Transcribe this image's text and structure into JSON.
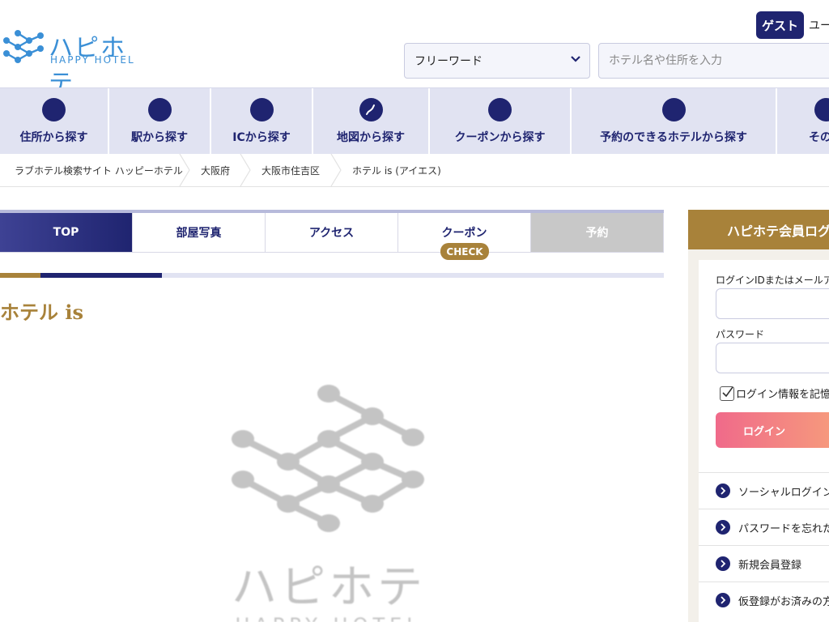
{
  "header": {
    "logo_jp": "ハピホテ",
    "logo_en": "HAPPY HOTEL",
    "guest_badge": "ゲスト",
    "user_text": "ユー",
    "search_type_selected": "フリーワード",
    "search_placeholder": "ホテル名や住所を入力"
  },
  "nav": {
    "items": [
      {
        "label": "住所から探す",
        "icon": "circle-icon"
      },
      {
        "label": "駅から探す",
        "icon": "circle-icon"
      },
      {
        "label": "ICから探す",
        "icon": "circle-icon"
      },
      {
        "label": "地図から探す",
        "icon": "japan-map-icon"
      },
      {
        "label": "クーポンから探す",
        "icon": "circle-icon"
      },
      {
        "label": "予約のできるホテルから探す",
        "icon": "circle-icon"
      },
      {
        "label": "その他",
        "icon": "circle-icon"
      }
    ]
  },
  "breadcrumb": {
    "items": [
      "ラブホテル検索サイト ハッピーホテル",
      "大阪府",
      "大阪市住吉区",
      "ホテル is (アイエス)"
    ]
  },
  "tabs": {
    "items": [
      "TOP",
      "部屋写真",
      "アクセス",
      "クーポン",
      "予約"
    ],
    "check_badge": "CHECK"
  },
  "hotel": {
    "title": "ホテル is",
    "placeholder_jp": "ハピホテ",
    "placeholder_en": "HAPPY HOTEL"
  },
  "sidebar": {
    "title": "ハピホテ会員ログイン",
    "login_id_label": "ログインIDまたはメールアドレス",
    "password_label": "パスワード",
    "remember_label": "ログイン情報を記憶する",
    "login_button": "ログイン",
    "links": [
      "ソーシャルログイン",
      "パスワードを忘れた方",
      "新規会員登録",
      "仮登録がお済みの方"
    ]
  },
  "colors": {
    "navy": "#1f2470",
    "gold": "#a8823a",
    "nav_bg": "#e1e3f2",
    "logo_blue": "#3a8fd6"
  }
}
